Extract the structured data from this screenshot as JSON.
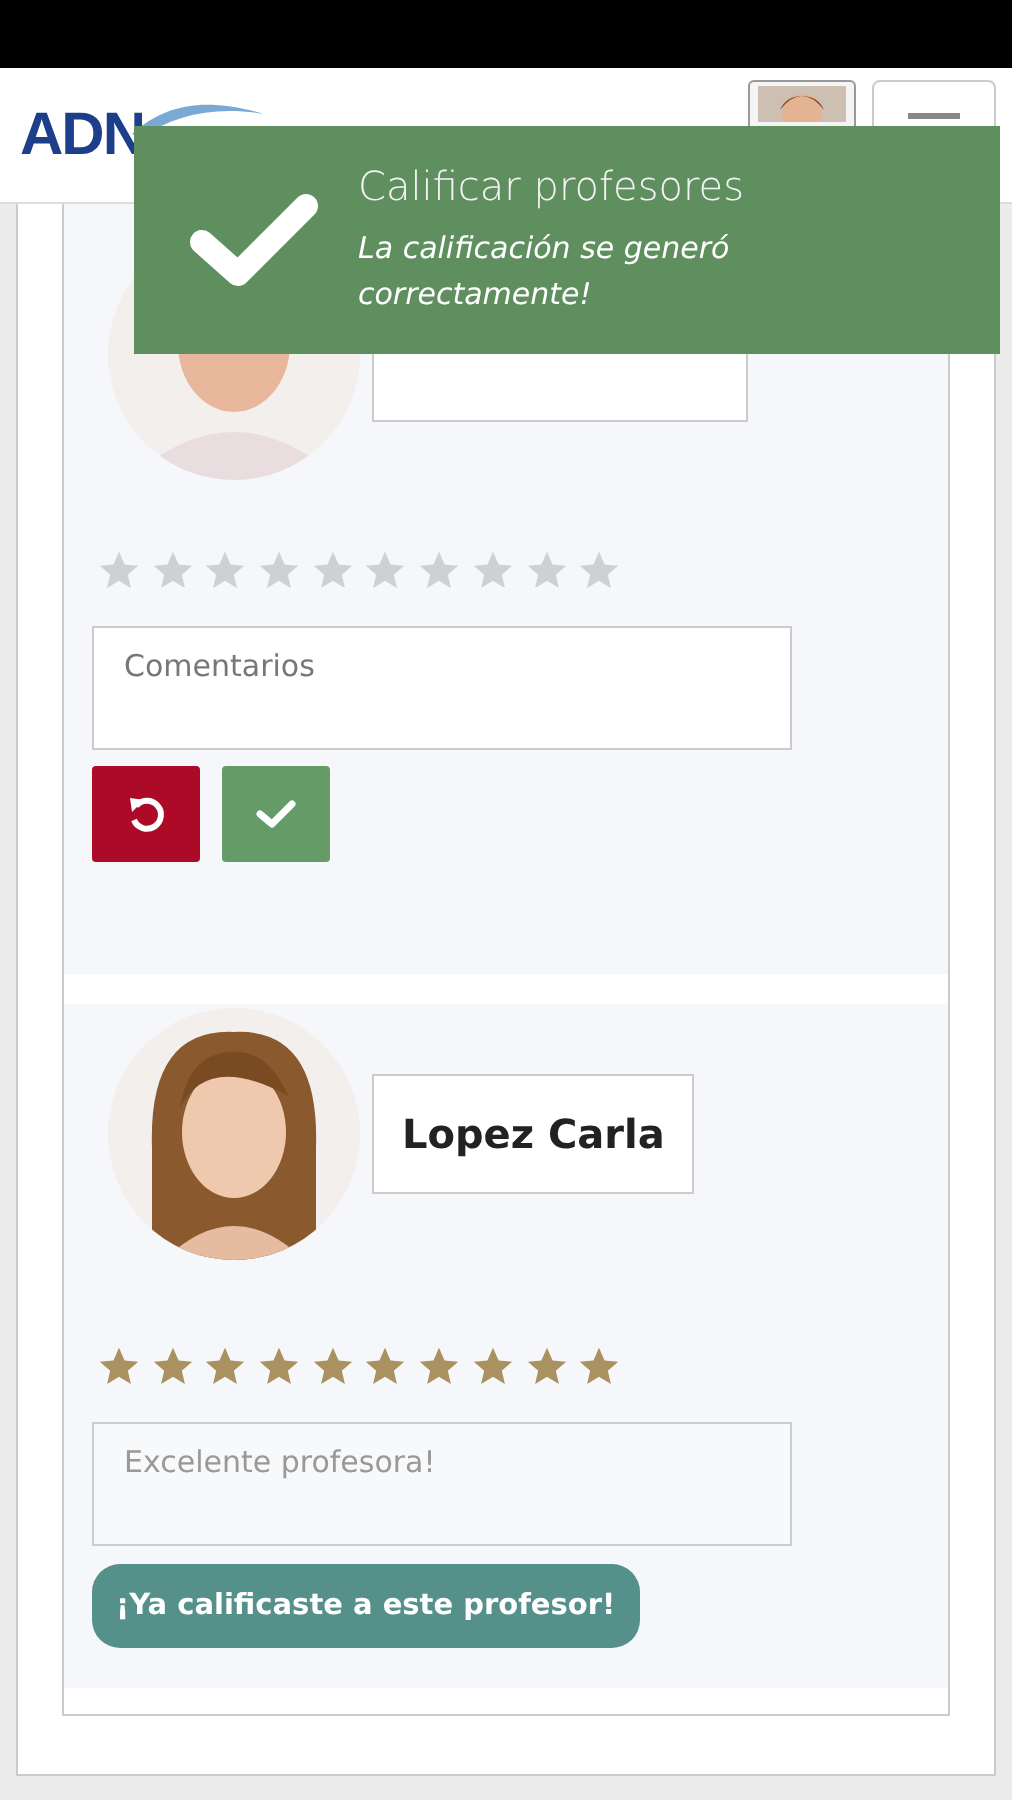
{
  "header": {
    "logo": "ADN"
  },
  "toast": {
    "title": "Calificar profesores",
    "message": "La calificación se generó correctamente!"
  },
  "teachers": [
    {
      "rated": false,
      "stars": 0,
      "comment": {
        "placeholder": "Comentarios"
      }
    },
    {
      "rated": true,
      "name": "Lopez Carla",
      "stars": 10,
      "comment": {
        "value": "Excelente profesora!"
      },
      "rated_message": "¡Ya calificaste a este profesor!"
    }
  ]
}
